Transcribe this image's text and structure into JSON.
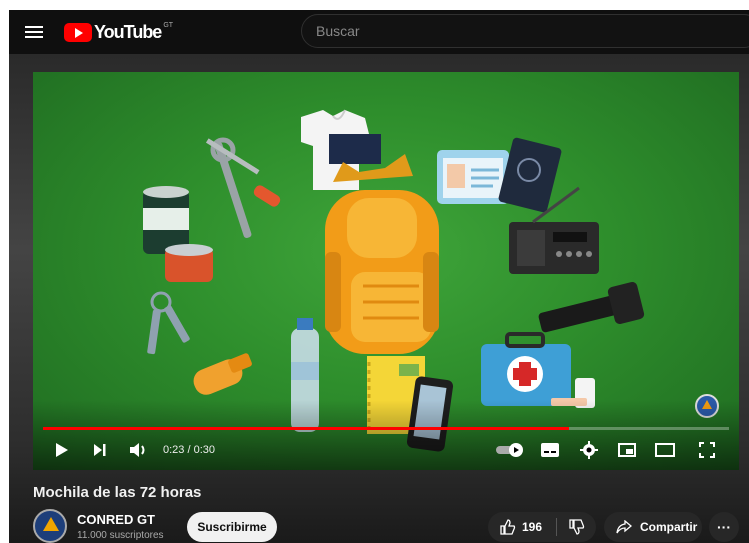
{
  "header": {
    "logo_text": "YouTube",
    "logo_country": "GT",
    "search_placeholder": "Buscar"
  },
  "player": {
    "time": "0:23 / 0:30",
    "progress_fraction": 0.767
  },
  "video": {
    "title": "Mochila de las 72 horas"
  },
  "channel": {
    "name": "CONRED GT",
    "subscribers": "11.000 suscriptores",
    "subscribe_label": "Suscribirme"
  },
  "actions": {
    "likes": "196",
    "share_label": "Compartir",
    "more_label": "···"
  },
  "colors": {
    "accent": "#ff0000",
    "background": "#0f0f0f",
    "video_green": "#2e8e2c"
  },
  "icons": [
    "menu-icon",
    "youtube-logo-icon",
    "play-icon",
    "next-icon",
    "volume-icon",
    "autoplay-toggle-icon",
    "subtitles-icon",
    "settings-icon",
    "miniplayer-icon",
    "theater-icon",
    "fullscreen-icon",
    "like-icon",
    "dislike-icon",
    "share-icon"
  ]
}
